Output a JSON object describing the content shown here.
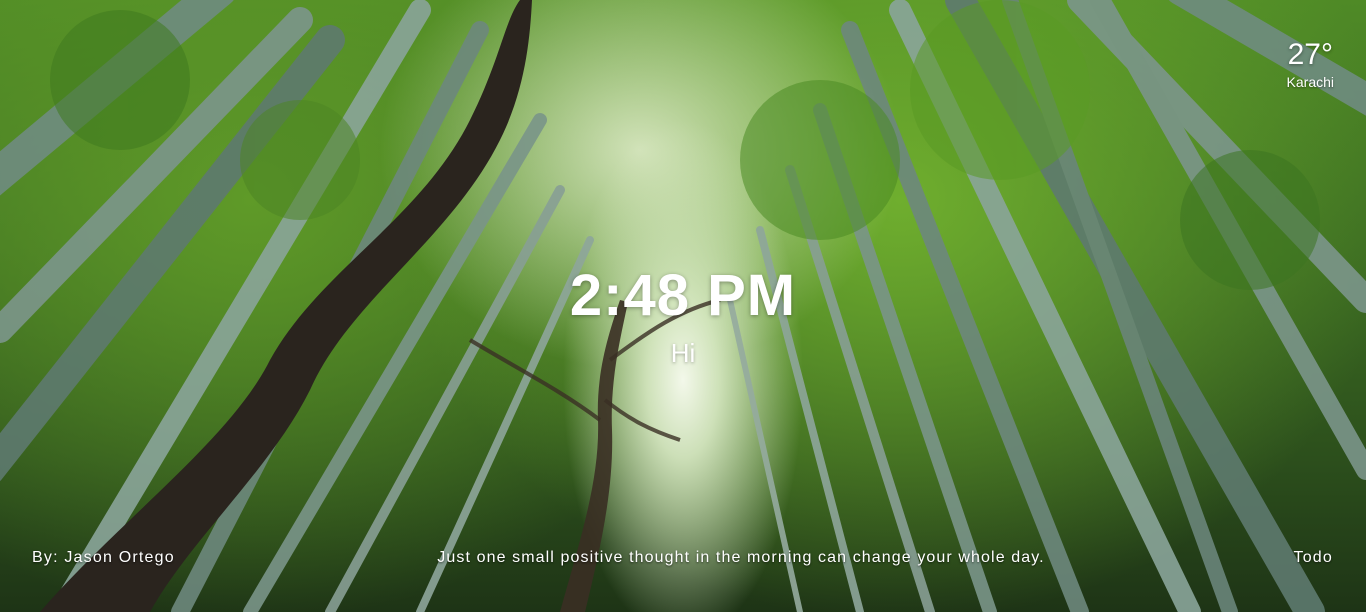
{
  "clock": {
    "time": "2:48 PM"
  },
  "greeting": {
    "text": "Hi"
  },
  "weather": {
    "temperature": "27°",
    "city": "Karachi"
  },
  "footer": {
    "credit": "By: Jason Ortego",
    "quote": "Just one small positive thought in the morning can change your whole day.",
    "todo_label": "Todo"
  },
  "background": {
    "description_colors": {
      "canopy": "#4f8a26",
      "light": "#f3f8ea",
      "bamboo": "#7d9a8e",
      "trunk": "#2a241e"
    }
  }
}
